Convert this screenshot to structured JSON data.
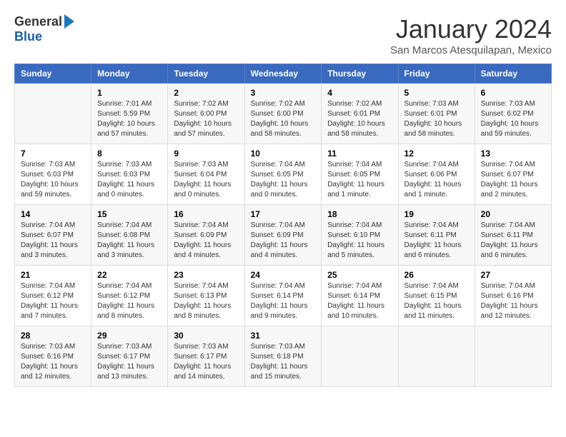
{
  "logo": {
    "general": "General",
    "blue": "Blue"
  },
  "title": "January 2024",
  "location": "San Marcos Atesquilapan, Mexico",
  "days_of_week": [
    "Sunday",
    "Monday",
    "Tuesday",
    "Wednesday",
    "Thursday",
    "Friday",
    "Saturday"
  ],
  "weeks": [
    [
      {
        "day": "",
        "sunrise": "",
        "sunset": "",
        "daylight": ""
      },
      {
        "day": "1",
        "sunrise": "Sunrise: 7:01 AM",
        "sunset": "Sunset: 5:59 PM",
        "daylight": "Daylight: 10 hours and 57 minutes."
      },
      {
        "day": "2",
        "sunrise": "Sunrise: 7:02 AM",
        "sunset": "Sunset: 6:00 PM",
        "daylight": "Daylight: 10 hours and 57 minutes."
      },
      {
        "day": "3",
        "sunrise": "Sunrise: 7:02 AM",
        "sunset": "Sunset: 6:00 PM",
        "daylight": "Daylight: 10 hours and 58 minutes."
      },
      {
        "day": "4",
        "sunrise": "Sunrise: 7:02 AM",
        "sunset": "Sunset: 6:01 PM",
        "daylight": "Daylight: 10 hours and 58 minutes."
      },
      {
        "day": "5",
        "sunrise": "Sunrise: 7:03 AM",
        "sunset": "Sunset: 6:01 PM",
        "daylight": "Daylight: 10 hours and 58 minutes."
      },
      {
        "day": "6",
        "sunrise": "Sunrise: 7:03 AM",
        "sunset": "Sunset: 6:02 PM",
        "daylight": "Daylight: 10 hours and 59 minutes."
      }
    ],
    [
      {
        "day": "7",
        "sunrise": "Sunrise: 7:03 AM",
        "sunset": "Sunset: 6:03 PM",
        "daylight": "Daylight: 10 hours and 59 minutes."
      },
      {
        "day": "8",
        "sunrise": "Sunrise: 7:03 AM",
        "sunset": "Sunset: 6:03 PM",
        "daylight": "Daylight: 11 hours and 0 minutes."
      },
      {
        "day": "9",
        "sunrise": "Sunrise: 7:03 AM",
        "sunset": "Sunset: 6:04 PM",
        "daylight": "Daylight: 11 hours and 0 minutes."
      },
      {
        "day": "10",
        "sunrise": "Sunrise: 7:04 AM",
        "sunset": "Sunset: 6:05 PM",
        "daylight": "Daylight: 11 hours and 0 minutes."
      },
      {
        "day": "11",
        "sunrise": "Sunrise: 7:04 AM",
        "sunset": "Sunset: 6:05 PM",
        "daylight": "Daylight: 11 hours and 1 minute."
      },
      {
        "day": "12",
        "sunrise": "Sunrise: 7:04 AM",
        "sunset": "Sunset: 6:06 PM",
        "daylight": "Daylight: 11 hours and 1 minute."
      },
      {
        "day": "13",
        "sunrise": "Sunrise: 7:04 AM",
        "sunset": "Sunset: 6:07 PM",
        "daylight": "Daylight: 11 hours and 2 minutes."
      }
    ],
    [
      {
        "day": "14",
        "sunrise": "Sunrise: 7:04 AM",
        "sunset": "Sunset: 6:07 PM",
        "daylight": "Daylight: 11 hours and 3 minutes."
      },
      {
        "day": "15",
        "sunrise": "Sunrise: 7:04 AM",
        "sunset": "Sunset: 6:08 PM",
        "daylight": "Daylight: 11 hours and 3 minutes."
      },
      {
        "day": "16",
        "sunrise": "Sunrise: 7:04 AM",
        "sunset": "Sunset: 6:09 PM",
        "daylight": "Daylight: 11 hours and 4 minutes."
      },
      {
        "day": "17",
        "sunrise": "Sunrise: 7:04 AM",
        "sunset": "Sunset: 6:09 PM",
        "daylight": "Daylight: 11 hours and 4 minutes."
      },
      {
        "day": "18",
        "sunrise": "Sunrise: 7:04 AM",
        "sunset": "Sunset: 6:10 PM",
        "daylight": "Daylight: 11 hours and 5 minutes."
      },
      {
        "day": "19",
        "sunrise": "Sunrise: 7:04 AM",
        "sunset": "Sunset: 6:11 PM",
        "daylight": "Daylight: 11 hours and 6 minutes."
      },
      {
        "day": "20",
        "sunrise": "Sunrise: 7:04 AM",
        "sunset": "Sunset: 6:11 PM",
        "daylight": "Daylight: 11 hours and 6 minutes."
      }
    ],
    [
      {
        "day": "21",
        "sunrise": "Sunrise: 7:04 AM",
        "sunset": "Sunset: 6:12 PM",
        "daylight": "Daylight: 11 hours and 7 minutes."
      },
      {
        "day": "22",
        "sunrise": "Sunrise: 7:04 AM",
        "sunset": "Sunset: 6:12 PM",
        "daylight": "Daylight: 11 hours and 8 minutes."
      },
      {
        "day": "23",
        "sunrise": "Sunrise: 7:04 AM",
        "sunset": "Sunset: 6:13 PM",
        "daylight": "Daylight: 11 hours and 8 minutes."
      },
      {
        "day": "24",
        "sunrise": "Sunrise: 7:04 AM",
        "sunset": "Sunset: 6:14 PM",
        "daylight": "Daylight: 11 hours and 9 minutes."
      },
      {
        "day": "25",
        "sunrise": "Sunrise: 7:04 AM",
        "sunset": "Sunset: 6:14 PM",
        "daylight": "Daylight: 11 hours and 10 minutes."
      },
      {
        "day": "26",
        "sunrise": "Sunrise: 7:04 AM",
        "sunset": "Sunset: 6:15 PM",
        "daylight": "Daylight: 11 hours and 11 minutes."
      },
      {
        "day": "27",
        "sunrise": "Sunrise: 7:04 AM",
        "sunset": "Sunset: 6:16 PM",
        "daylight": "Daylight: 11 hours and 12 minutes."
      }
    ],
    [
      {
        "day": "28",
        "sunrise": "Sunrise: 7:03 AM",
        "sunset": "Sunset: 6:16 PM",
        "daylight": "Daylight: 11 hours and 12 minutes."
      },
      {
        "day": "29",
        "sunrise": "Sunrise: 7:03 AM",
        "sunset": "Sunset: 6:17 PM",
        "daylight": "Daylight: 11 hours and 13 minutes."
      },
      {
        "day": "30",
        "sunrise": "Sunrise: 7:03 AM",
        "sunset": "Sunset: 6:17 PM",
        "daylight": "Daylight: 11 hours and 14 minutes."
      },
      {
        "day": "31",
        "sunrise": "Sunrise: 7:03 AM",
        "sunset": "Sunset: 6:18 PM",
        "daylight": "Daylight: 11 hours and 15 minutes."
      },
      {
        "day": "",
        "sunrise": "",
        "sunset": "",
        "daylight": ""
      },
      {
        "day": "",
        "sunrise": "",
        "sunset": "",
        "daylight": ""
      },
      {
        "day": "",
        "sunrise": "",
        "sunset": "",
        "daylight": ""
      }
    ]
  ]
}
